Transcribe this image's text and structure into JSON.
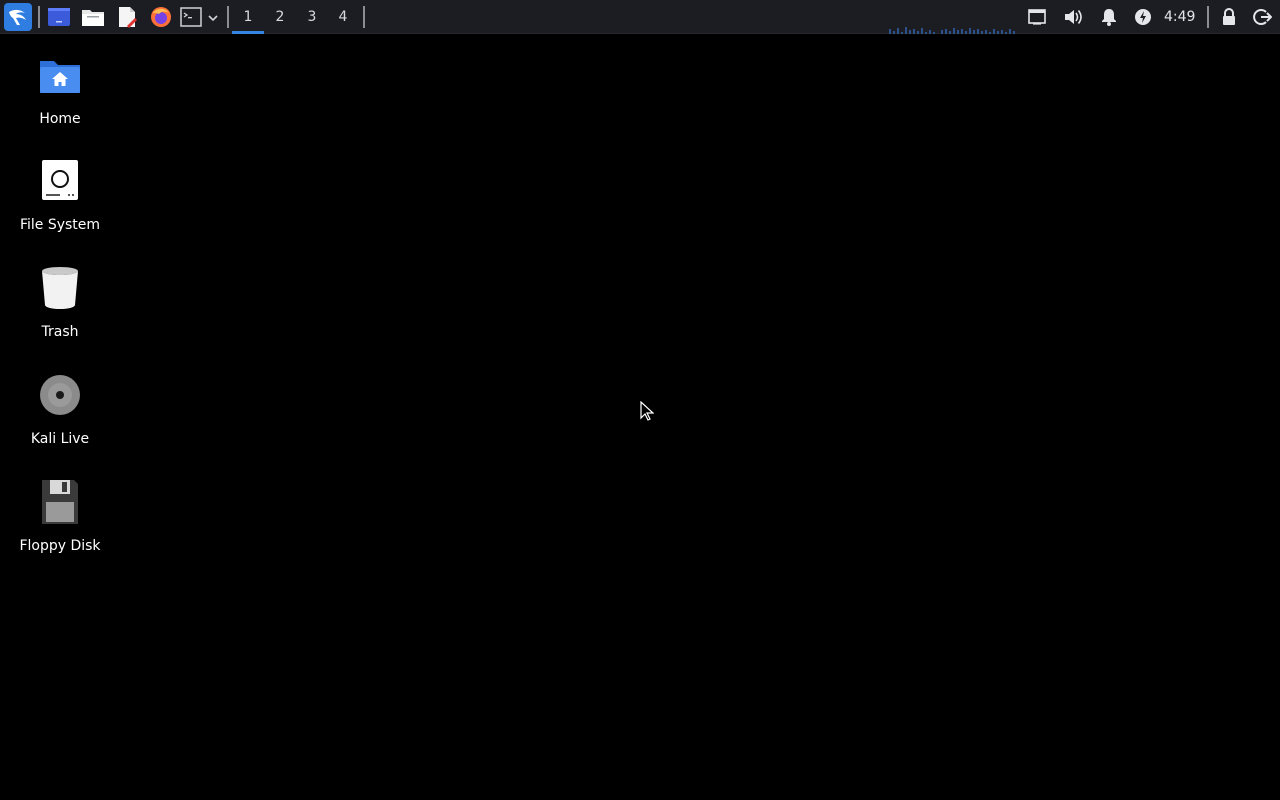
{
  "panel": {
    "launchers": [
      {
        "name": "kali-menu-icon"
      },
      {
        "name": "terminal-emulator-icon"
      },
      {
        "name": "file-manager-icon"
      },
      {
        "name": "text-editor-icon"
      },
      {
        "name": "firefox-icon"
      },
      {
        "name": "terminal-icon"
      }
    ],
    "workspaces": [
      "1",
      "2",
      "3",
      "4"
    ],
    "active_workspace": "1",
    "clock": "4:49",
    "accent_color": "#3584e4"
  },
  "desktop": {
    "icons": [
      {
        "label": "Home",
        "icon": "home-folder-icon"
      },
      {
        "label": "File System",
        "icon": "drive-icon"
      },
      {
        "label": "Trash",
        "icon": "trash-icon"
      },
      {
        "label": "Kali Live",
        "icon": "optical-disc-icon"
      },
      {
        "label": "Floppy Disk",
        "icon": "floppy-disk-icon"
      }
    ]
  }
}
